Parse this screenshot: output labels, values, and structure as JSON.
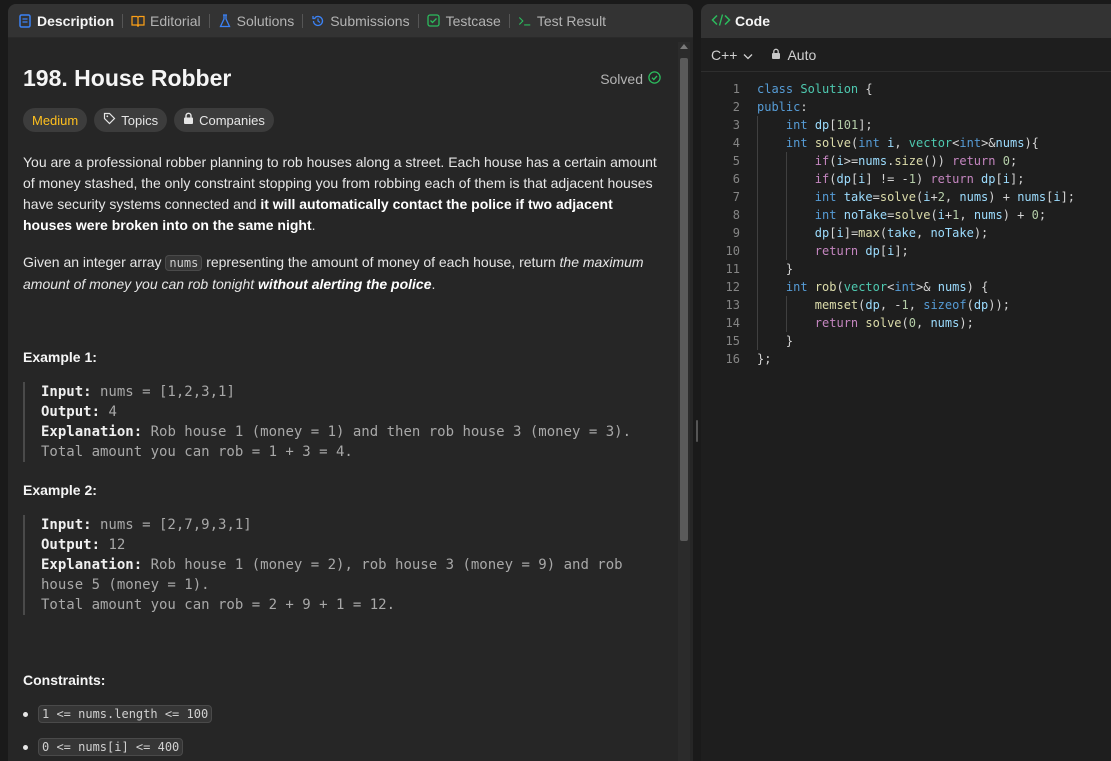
{
  "tabs": [
    {
      "label": "Description",
      "icon": "description-icon"
    },
    {
      "label": "Editorial",
      "icon": "book-icon"
    },
    {
      "label": "Solutions",
      "icon": "flask-icon"
    },
    {
      "label": "Submissions",
      "icon": "history-icon"
    },
    {
      "label": "Testcase",
      "icon": "checkbox-icon"
    },
    {
      "label": "Test Result",
      "icon": "terminal-icon"
    }
  ],
  "problem": {
    "title": "198. House Robber",
    "status": "Solved",
    "difficulty": "Medium",
    "topics_label": "Topics",
    "companies_label": "Companies",
    "p1_a": "You are a professional robber planning to rob houses along a street. Each house has a certain amount of money stashed, the only constraint stopping you from robbing each of them is that adjacent houses have security systems connected and ",
    "p1_b": "it will automatically contact the police if two adjacent houses were broken into on the same night",
    "p1_c": ".",
    "p2_a": "Given an integer array ",
    "p2_code": "nums",
    "p2_b": " representing the amount of money of each house, return ",
    "p2_c": "the maximum amount of money you can rob tonight ",
    "p2_d": "without alerting the police",
    "p2_e": "."
  },
  "examples": [
    {
      "title": "Example 1:",
      "input_label": "Input:",
      "input": " nums = [1,2,3,1]",
      "output_label": "Output:",
      "output": " 4",
      "expl_label": "Explanation:",
      "expl1": " Rob house 1 (money = 1) and then rob house 3 (money = 3).",
      "expl2": "Total amount you can rob = 1 + 3 = 4."
    },
    {
      "title": "Example 2:",
      "input_label": "Input:",
      "input": " nums = [2,7,9,3,1]",
      "output_label": "Output:",
      "output": " 12",
      "expl_label": "Explanation:",
      "expl1": " Rob house 1 (money = 2), rob house 3 (money = 9) and rob",
      "expl1b": "house 5 (money = 1).",
      "expl2": "Total amount you can rob = 2 + 9 + 1 = 12."
    }
  ],
  "constraints": {
    "title": "Constraints:",
    "items": [
      "1 <= nums.length <= 100",
      "0 <= nums[i] <= 400"
    ]
  },
  "code_panel": {
    "tab_label": "Code",
    "language": "C++",
    "mode": "Auto",
    "line_numbers": [
      "1",
      "2",
      "3",
      "4",
      "5",
      "6",
      "7",
      "8",
      "9",
      "10",
      "11",
      "12",
      "13",
      "14",
      "15",
      "16"
    ]
  },
  "colors": {
    "accent_difficulty": "#ffc01e",
    "solved_check": "#2cbb5d",
    "keyword": "#569cd6",
    "function": "#dcdcaa",
    "type": "#4ec9b0",
    "number": "#b5cea8"
  }
}
